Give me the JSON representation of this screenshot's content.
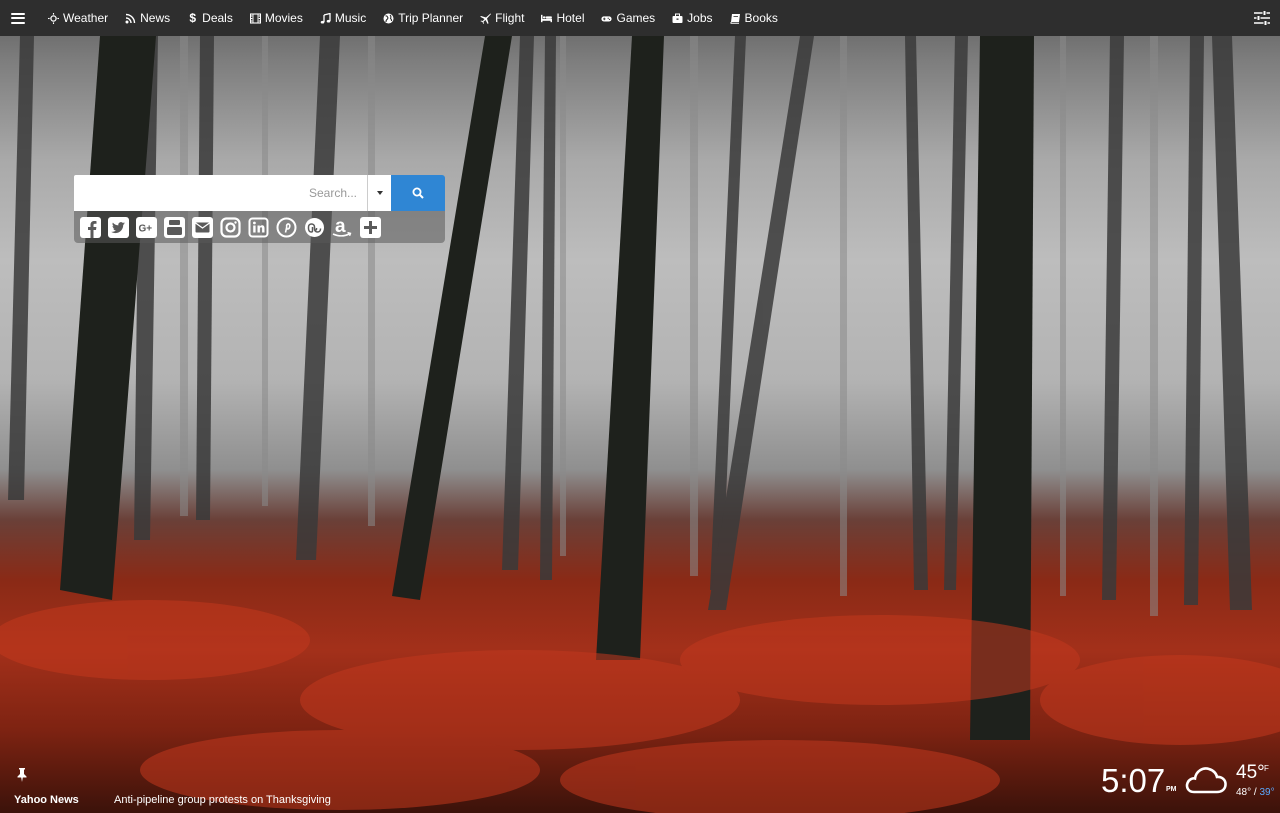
{
  "nav": {
    "items": [
      {
        "label": "Weather",
        "icon": "sun-icon"
      },
      {
        "label": "News",
        "icon": "rss-icon"
      },
      {
        "label": "Deals",
        "icon": "dollar-icon"
      },
      {
        "label": "Movies",
        "icon": "film-icon"
      },
      {
        "label": "Music",
        "icon": "music-icon"
      },
      {
        "label": "Trip Planner",
        "icon": "globe-icon"
      },
      {
        "label": "Flight",
        "icon": "plane-icon"
      },
      {
        "label": "Hotel",
        "icon": "bed-icon"
      },
      {
        "label": "Games",
        "icon": "gamepad-icon"
      },
      {
        "label": "Jobs",
        "icon": "briefcase-icon"
      },
      {
        "label": "Books",
        "icon": "book-icon"
      }
    ],
    "glyphs": {
      "dollar": "$"
    }
  },
  "search": {
    "placeholder": "Search...",
    "value": ""
  },
  "social": [
    "facebook-icon",
    "twitter-icon",
    "google-plus-icon",
    "youtube-icon",
    "email-icon",
    "instagram-icon",
    "linkedin-icon",
    "pinterest-icon",
    "stumbleupon-icon",
    "amazon-icon",
    "add-icon"
  ],
  "news": {
    "source": "Yahoo News",
    "headline": "Anti-pipeline group protests on Thanksgiving"
  },
  "clock": {
    "time": "5:07",
    "ampm": "PM"
  },
  "weather": {
    "current": "45°",
    "unit": "F",
    "high": "48°",
    "separator": "/",
    "low": "39°",
    "condition_icon": "cloud-icon"
  },
  "colors": {
    "topbar": "#2e2e2e",
    "search_button": "#2f86d4",
    "low_temp": "#5aa9ff"
  }
}
